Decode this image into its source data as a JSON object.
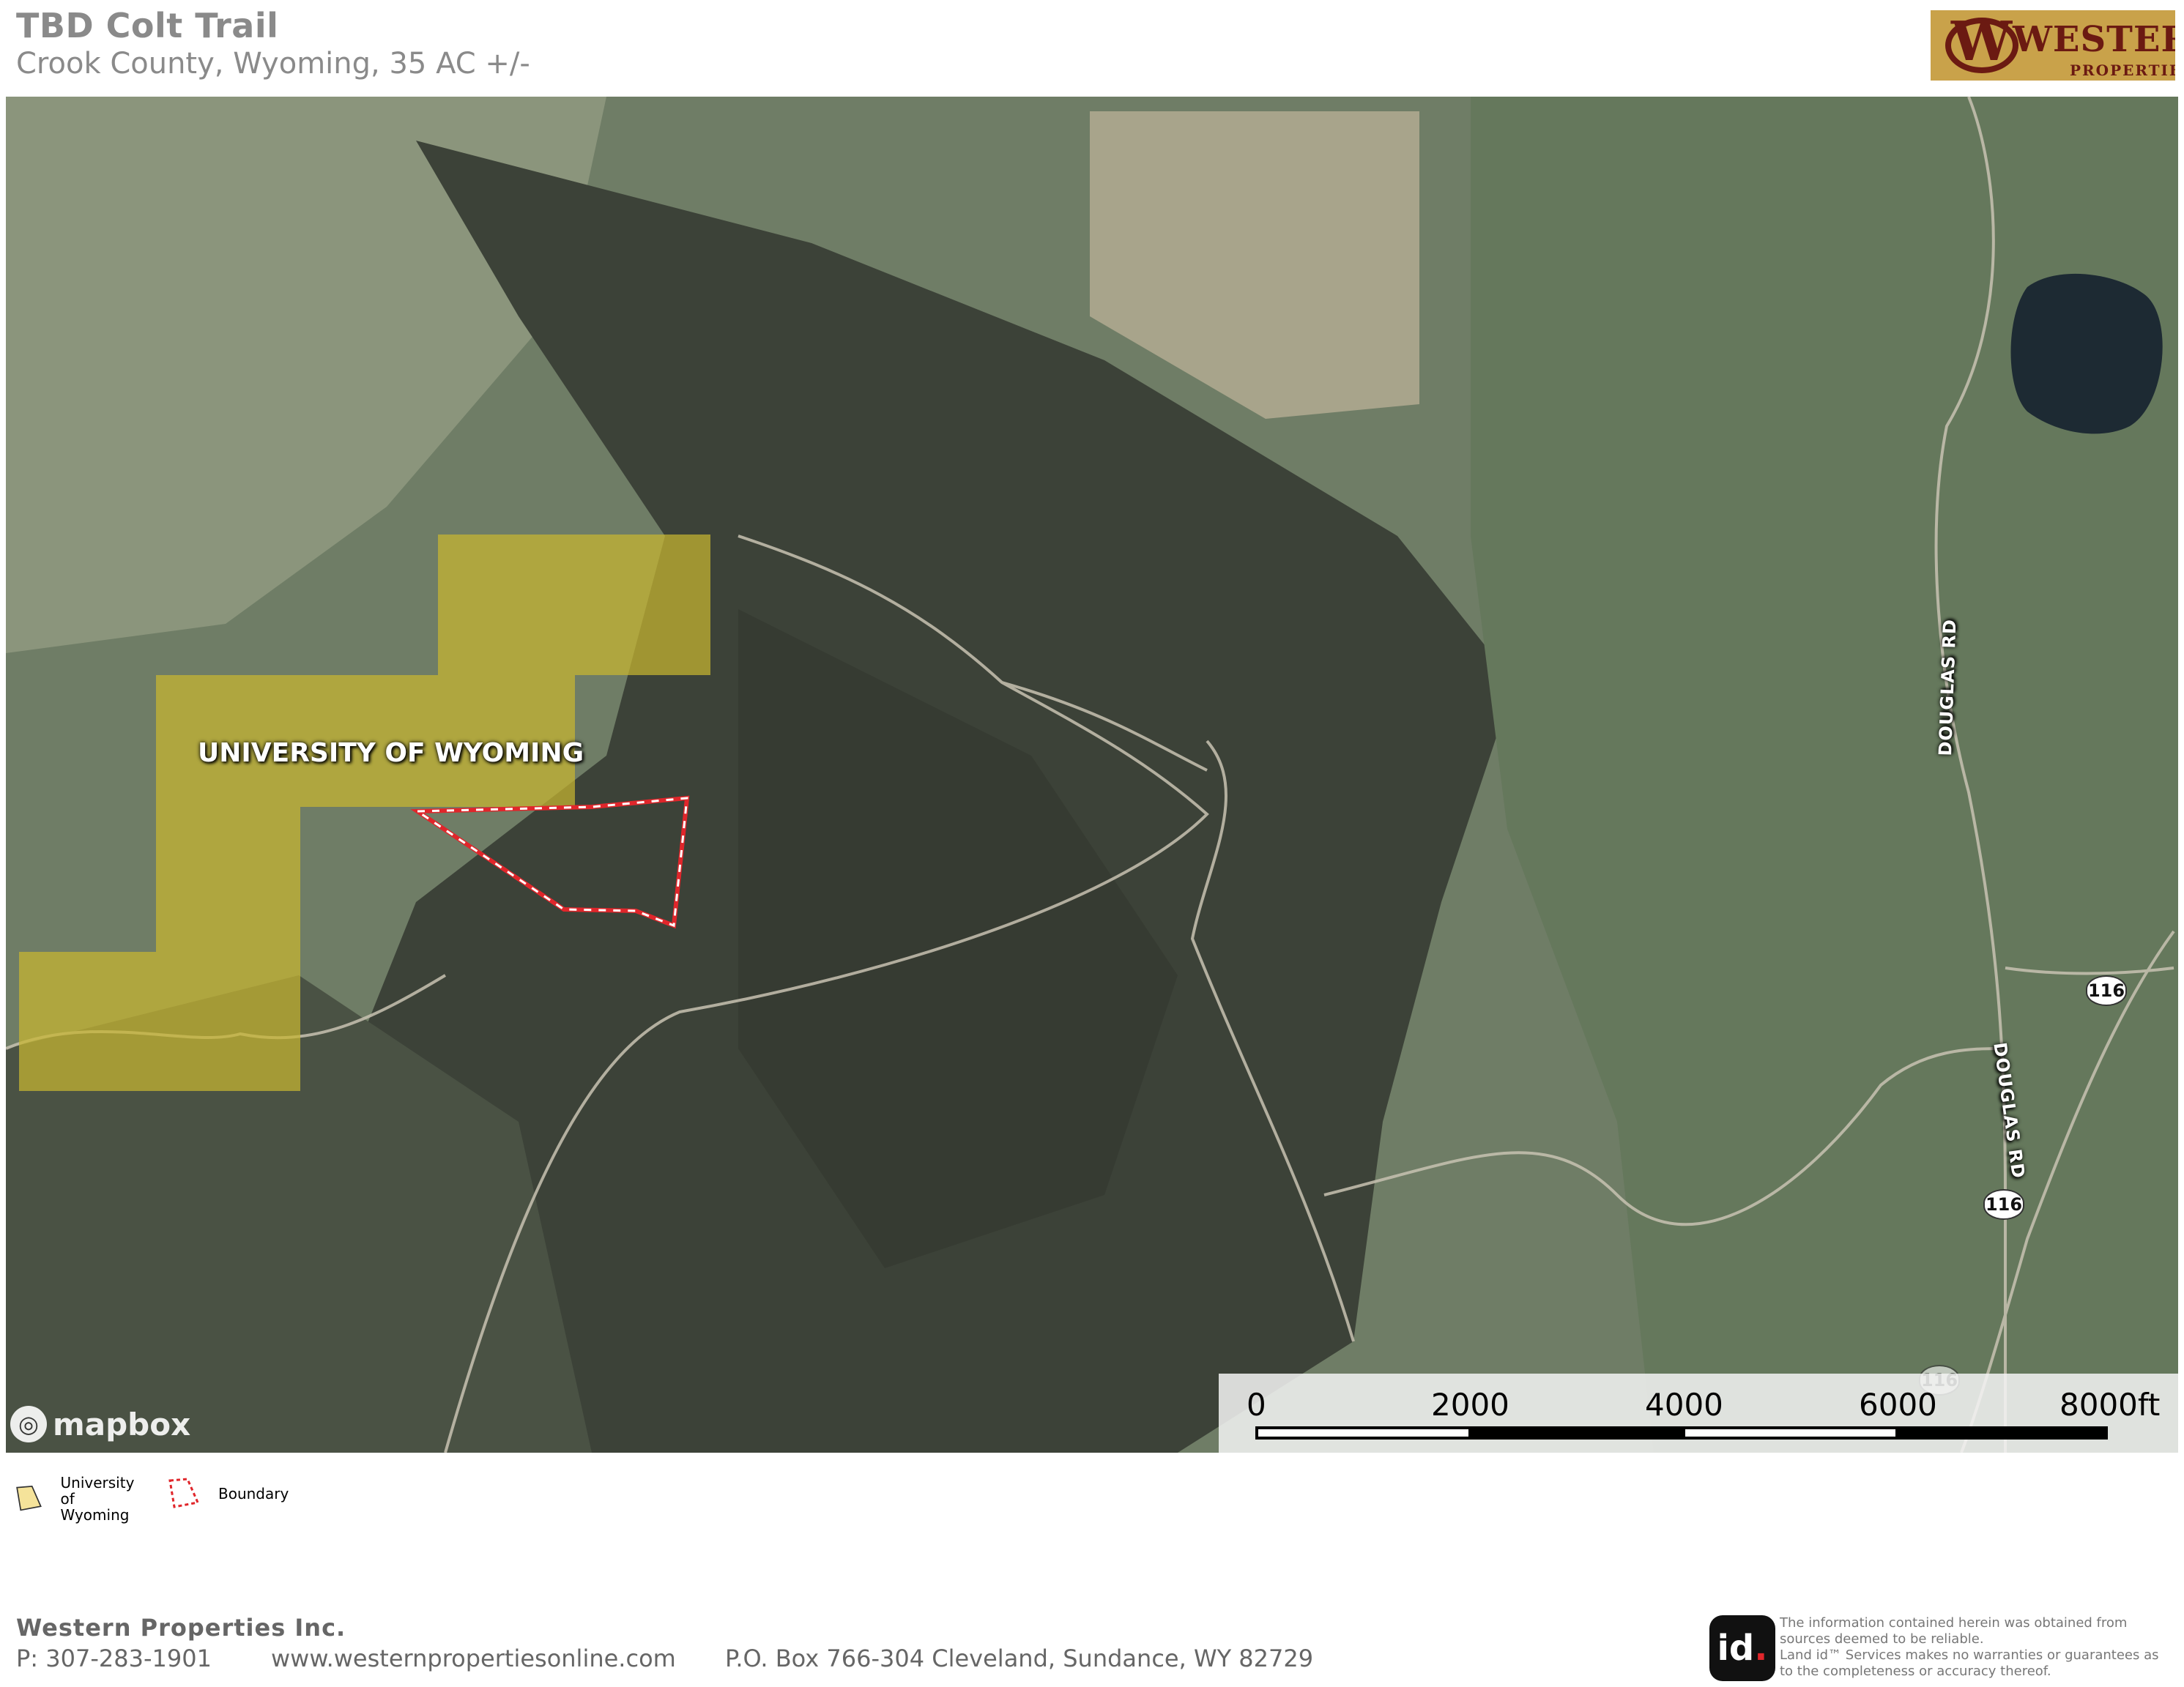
{
  "header": {
    "title": "TBD Colt Trail",
    "subtitle": "Crook County, Wyoming, 35 AC +/-"
  },
  "logo": {
    "name": "WESTERN",
    "tagline": "PROPERTIES",
    "colors": {
      "background": "#c9a24a",
      "ink": "#6b1a12"
    }
  },
  "map": {
    "basemap": "satellite",
    "labels": {
      "university_parcel": "UNIVERSITY OF WYOMING",
      "road_1": "DOUGLAS RD",
      "road_2": "DOUGLAS RD",
      "highway_shields": [
        "116",
        "116",
        "116"
      ]
    },
    "attribution": "mapbox",
    "scale": {
      "ticks": [
        "0",
        "2000",
        "4000",
        "6000",
        "8000ft"
      ]
    },
    "colors": {
      "university_fill": "#c8b631",
      "boundary_stroke": "#e0262b"
    }
  },
  "legend": {
    "items": [
      {
        "label_line1": "University of",
        "label_line2": "Wyoming",
        "icon": "polygon-fill-icon",
        "color": "#f5e39a"
      },
      {
        "label": "Boundary",
        "icon": "polygon-dashed-icon",
        "color": "#e0262b"
      }
    ]
  },
  "footer": {
    "company": "Western  Properties Inc.",
    "phone": "P: 307-283-1901",
    "website": "www.westernpropertiesonline.com",
    "address": "P.O. Box 766-304 Cleveland, Sundance, WY  82729",
    "id_logo": "id",
    "disclaimer_1": "The information contained herein was obtained from sources deemed to be reliable.",
    "disclaimer_2": "Land id™ Services makes no warranties or guarantees as to the completeness or accuracy thereof."
  }
}
